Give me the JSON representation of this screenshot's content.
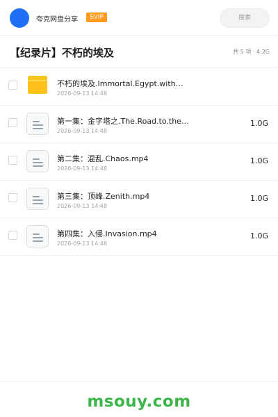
{
  "header": {
    "app_name": "夸克网盘分享",
    "badge": "SVIP",
    "search_placeholder": "搜索"
  },
  "folder": {
    "title": "【纪录片】不朽的埃及",
    "meta": "共 5 项 · 4.2G"
  },
  "files": [
    {
      "type": "folder",
      "icon": "folder-icon",
      "name": "不朽的埃及.Immortal.Egypt.with…",
      "date": "2026-09-13 14:48",
      "size": ""
    },
    {
      "type": "file",
      "icon": "document-icon",
      "name": "第一集：金字塔之.The.Road.to.the.…",
      "date": "2026-09-13 14:48",
      "size": "1.0G"
    },
    {
      "type": "file",
      "icon": "document-icon",
      "name": "第二集：混乱.Chaos.mp4",
      "date": "2026-09-13 14:48",
      "size": "1.0G"
    },
    {
      "type": "file",
      "icon": "document-icon",
      "name": "第三集：顶峰.Zenith.mp4",
      "date": "2026-09-13 14:48",
      "size": "1.0G"
    },
    {
      "type": "file",
      "icon": "document-icon",
      "name": "第四集：入侵.Invasion.mp4",
      "date": "2026-09-13 14:48",
      "size": "1.0G"
    }
  ],
  "footer": {
    "watermark": "msouy.com"
  },
  "colors": {
    "avatar": "#1e6ff5",
    "badge": "#ff9a1f",
    "folder": "#ffc21c",
    "watermark": "#3bb54a"
  }
}
